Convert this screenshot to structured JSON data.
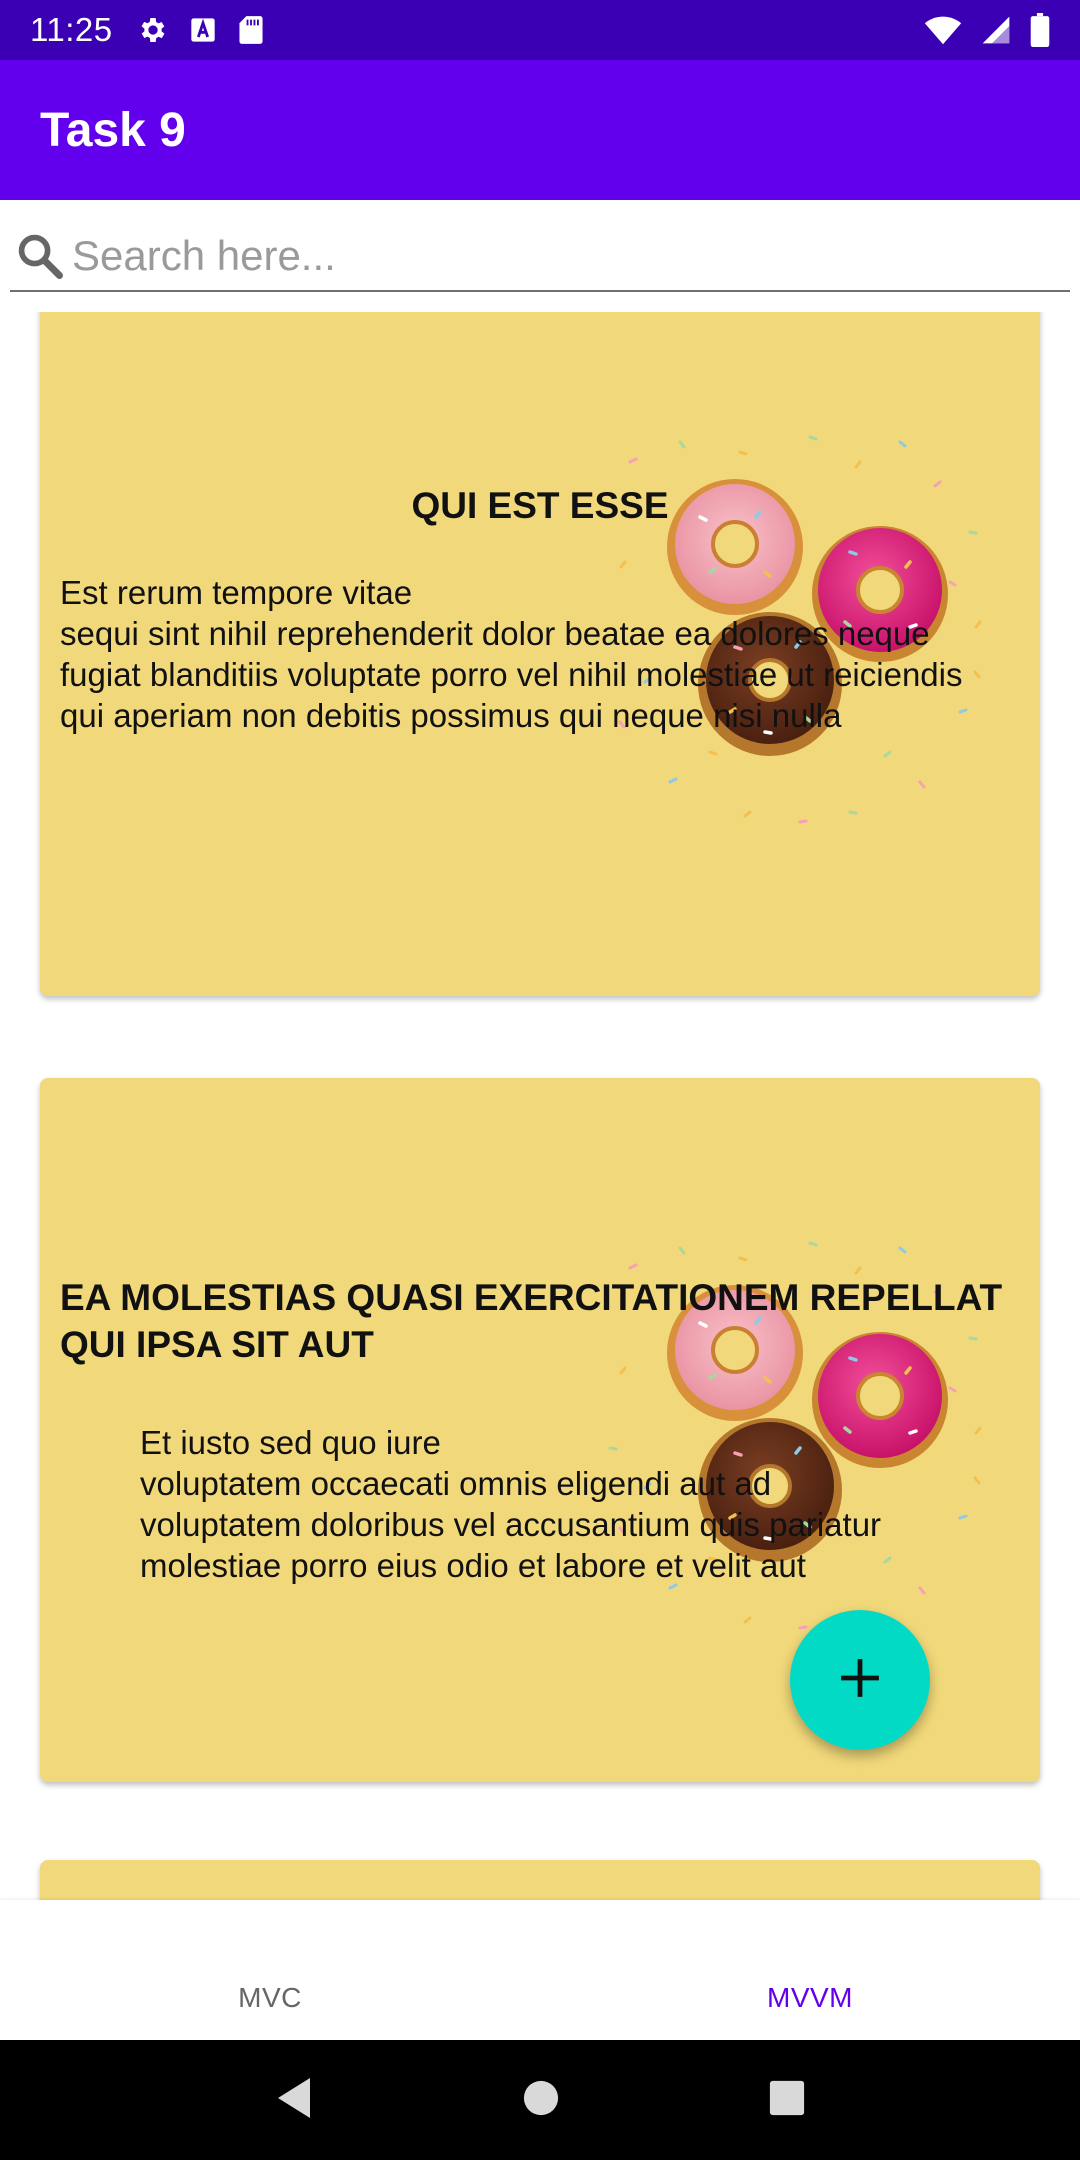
{
  "status_bar": {
    "time": "11:25",
    "left_icons": [
      "gear-icon",
      "font-a-icon",
      "sd-card-icon"
    ],
    "right_icons": [
      "wifi-icon",
      "cell-signal-icon",
      "battery-icon"
    ]
  },
  "app_bar": {
    "title": "Task 9"
  },
  "search": {
    "placeholder": "Search here...",
    "value": ""
  },
  "posts": [
    {
      "title": "QUI EST ESSE",
      "body": "Est rerum tempore vitae\nsequi sint nihil reprehenderit dolor beatae ea dolores neque\nfugiat blanditiis voluptate porro vel nihil molestiae ut reiciendis\nqui aperiam non debitis possimus qui neque nisi nulla"
    },
    {
      "title": "EA MOLESTIAS QUASI EXERCITATIONEM REPELLAT QUI IPSA SIT AUT",
      "body": "Et iusto sed quo iure\nvoluptatem occaecati omnis eligendi aut ad\nvoluptatem doloribus vel accusantium quis pariatur\nmolestiae porro eius odio et labore et velit aut"
    }
  ],
  "fab": {
    "icon": "plus-icon"
  },
  "bottom_nav": {
    "items": [
      {
        "label": "MVC",
        "selected": false
      },
      {
        "label": "MVVM",
        "selected": true
      }
    ],
    "selected_color": "#6200EE"
  },
  "system_nav": {
    "icons": [
      "back-icon",
      "home-icon",
      "recents-icon"
    ]
  },
  "colors": {
    "status_bar": "#3B00B3",
    "app_bar": "#6200EE",
    "card_background": "#F1D87A",
    "fab": "#03DAC5"
  }
}
